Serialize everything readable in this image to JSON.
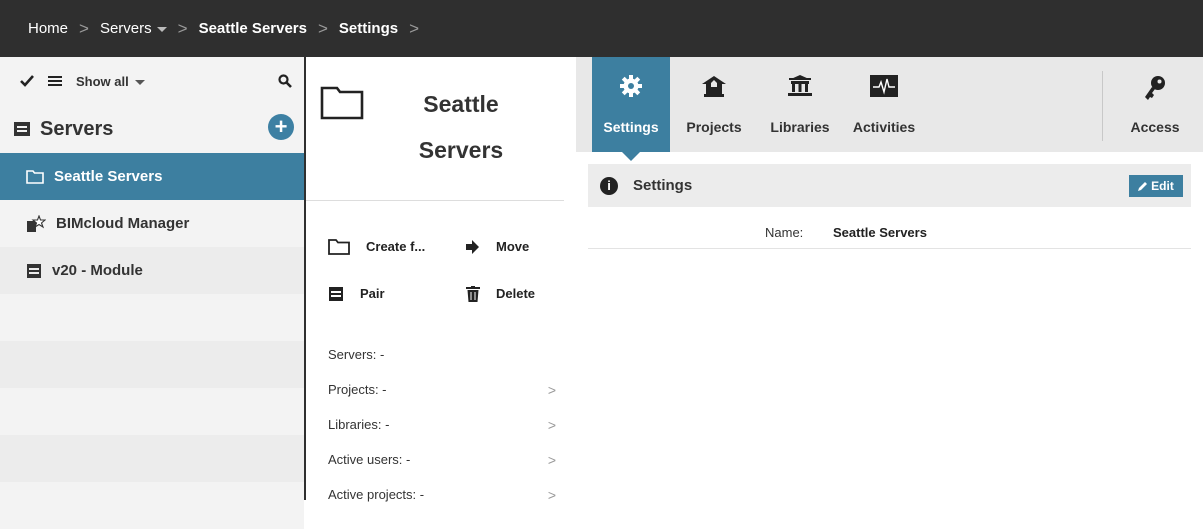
{
  "breadcrumb": {
    "home": "Home",
    "servers": "Servers",
    "seattle": "Seattle Servers",
    "settings": "Settings",
    "separator": ">"
  },
  "tree": {
    "show_all": "Show all",
    "header": "Servers",
    "add_label": "+",
    "items": [
      {
        "label": "Seattle Servers",
        "icon": "folder-icon",
        "selected": true
      },
      {
        "label": "BIMcloud Manager",
        "icon": "manager-star-icon"
      },
      {
        "label": "v20 - Module",
        "icon": "module-icon"
      }
    ]
  },
  "detail": {
    "title_line1": "Seattle",
    "title_line2": "Servers",
    "actions": {
      "create": "Create f...",
      "move": "Move",
      "pair": "Pair",
      "delete": "Delete"
    },
    "stats": [
      {
        "label": "Servers: -",
        "chevron": ""
      },
      {
        "label": "Projects: -",
        "chevron": ">"
      },
      {
        "label": "Libraries: -",
        "chevron": ">"
      },
      {
        "label": "Active users: -",
        "chevron": ">"
      },
      {
        "label": "Active projects: -",
        "chevron": ">"
      }
    ]
  },
  "tabs": {
    "settings": "Settings",
    "projects": "Projects",
    "libraries": "Libraries",
    "activities": "Activities",
    "access": "Access"
  },
  "settings_panel": {
    "title": "Settings",
    "info_label": "i",
    "edit": "Edit",
    "name_label": "Name:",
    "name_value": "Seattle Servers"
  },
  "colors": {
    "accent": "#3d7fa0",
    "topbar": "#2f2f2f",
    "panel_bg": "#ececec"
  }
}
